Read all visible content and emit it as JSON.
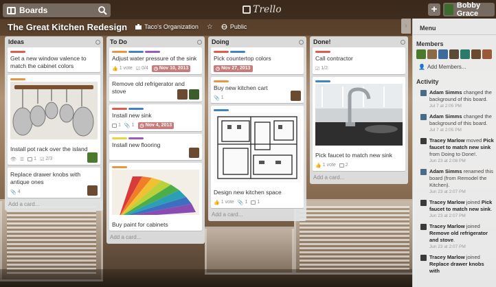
{
  "topbar": {
    "boards_label": "Boards",
    "logo_text": "Trello",
    "add_label": "+",
    "user_name": "Bobby Grace"
  },
  "board": {
    "title": "The Great Kitchen Redesign",
    "org": "Taco's Organization",
    "visibility": "Public"
  },
  "lists": [
    {
      "title": "Ideas",
      "add_card": "Add a card...",
      "cards": [
        {
          "labels": [
            "#e05a4e"
          ],
          "title": "Get a new window valence to match the cabinet colors"
        },
        {
          "labels": [
            "#e89543"
          ],
          "title": "Install pot rack over the island",
          "cover": "pots",
          "checklist": "2/3",
          "comments": "1",
          "members": [
            "#4c7a2c"
          ]
        },
        {
          "labels": [],
          "title": "Replace drawer knobs with antique ones",
          "attachments": "4",
          "members": [
            "#6b4a32"
          ]
        }
      ]
    },
    {
      "title": "To Do",
      "add_card": "Add a card...",
      "cards": [
        {
          "labels": [
            "#e89543",
            "#3f83c6",
            "#9a5ab9"
          ],
          "title": "Adjust water pressure of the sink",
          "votes": "1 vote",
          "checklist": "0/4",
          "due": "Nov 10, 2013"
        },
        {
          "labels": [],
          "title": "Remove old refrigerator and stove",
          "members": [
            "#6b4a32",
            "#3c5c2a"
          ]
        },
        {
          "labels": [
            "#e05a4e",
            "#3f83c6"
          ],
          "title": "Install new sink",
          "comments": "1",
          "attachments": "1",
          "due": "Nov 4, 2013"
        },
        {
          "labels": [
            "#e8d443",
            "#9a5ab9"
          ],
          "title": "Install new flooring",
          "members": [
            "#6b4a32"
          ]
        },
        {
          "labels": [
            "#e89543"
          ],
          "title": "Buy paint for cabinets",
          "cover": "swatches"
        }
      ]
    },
    {
      "title": "Doing",
      "add_card": "Add a card...",
      "cards": [
        {
          "labels": [
            "#e05a4e",
            "#3f83c6"
          ],
          "title": "Pick countertop colors",
          "due": "Nov 27, 2013"
        },
        {
          "labels": [
            "#e89543"
          ],
          "title": "Buy new kitchen cart",
          "attachments": "1",
          "members": [
            "#6b4a32"
          ]
        },
        {
          "labels": [
            "#3f83c6"
          ],
          "title": "Design new kitchen space",
          "cover": "plan",
          "votes": "1 vote",
          "attachments": "1",
          "comments": "1"
        }
      ]
    },
    {
      "title": "Done!",
      "add_card": "Add a card...",
      "cards": [
        {
          "labels": [
            "#e05a4e"
          ],
          "title": "Call contractor",
          "checklist": "1/2"
        },
        {
          "labels": [
            "#3f83c6"
          ],
          "title": "Pick faucet to match new sink",
          "cover": "faucet",
          "votes": "1 vote",
          "comments": "2"
        }
      ]
    }
  ],
  "panel": {
    "title": "Menu",
    "members_heading": "Members",
    "add_members": "Add Members...",
    "member_colors": [
      "#4c7a2c",
      "#8b6a4a",
      "#3f6b9a",
      "#5a4a3a",
      "#2e7a6a",
      "#6b4a32",
      "#9a5a3a"
    ],
    "activity_heading": "Activity",
    "activity": [
      {
        "user": "Adam Simms",
        "text": " changed the background of this board.",
        "time": "Jul 7 at 2:05 PM",
        "color": "#4a6a8a"
      },
      {
        "user": "Adam Simms",
        "text": " changed the background of this board.",
        "time": "Jul 7 at 2:05 PM",
        "color": "#4a6a8a"
      },
      {
        "user": "Tracey Marlow",
        "text": " moved ",
        "card": "Pick faucet to match new sink",
        "rest": " from Doing to Done!.",
        "time": "Jun 23 at 2:08 PM",
        "color": "#3a3a3a"
      },
      {
        "user": "Adam Simms",
        "text": " renamed this board (from Remodel the Kitchen).",
        "time": "Jun 23 at 2:07 PM",
        "color": "#4a6a8a"
      },
      {
        "user": "Tracey Marlow",
        "text": " joined ",
        "card": "Pick faucet to match new sink",
        "rest": ".",
        "time": "Jun 23 at 2:07 PM",
        "color": "#3a3a3a"
      },
      {
        "user": "Tracey Marlow",
        "text": " joined ",
        "card": "Remove old refrigerator and stove",
        "rest": ".",
        "time": "Jun 23 at 2:07 PM",
        "color": "#3a3a3a"
      },
      {
        "user": "Tracey Marlow",
        "text": " joined ",
        "card": "Replace drawer knobs with",
        "rest": "",
        "time": "",
        "color": "#3a3a3a"
      }
    ]
  }
}
